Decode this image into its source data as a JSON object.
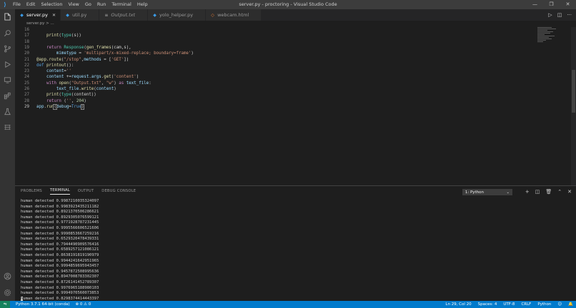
{
  "window": {
    "title": "server.py - proctoring - Visual Studio Code",
    "menu": [
      "File",
      "Edit",
      "Selection",
      "View",
      "Go",
      "Run",
      "Terminal",
      "Help"
    ],
    "controls": [
      "—",
      "❐",
      "✕"
    ]
  },
  "activity_bar": [
    "files-icon",
    "search-icon",
    "source-control-icon",
    "run-debug-icon",
    "remote-explorer-icon",
    "extensions-icon",
    "test-icon",
    "database-icon",
    "account-icon",
    "settings-gear-icon"
  ],
  "tabs": [
    {
      "label": "server.py",
      "icon": "python",
      "active": true
    },
    {
      "label": "util.py",
      "icon": "python",
      "active": false
    },
    {
      "label": "Output.txt",
      "icon": "text",
      "active": false
    },
    {
      "label": "yolo_helper.py",
      "icon": "python",
      "active": false
    },
    {
      "label": "webcam.html",
      "icon": "html",
      "active": false
    }
  ],
  "tab_actions": [
    "▷",
    "◫",
    "···"
  ],
  "breadcrumb": "server.py > ...",
  "editor": {
    "line_numbers": [
      "16",
      "17",
      "18",
      "19",
      "20",
      "21",
      "22",
      "23",
      "24",
      "25",
      "26",
      "27",
      "28",
      "29"
    ],
    "current_line": "29"
  },
  "panel": {
    "tabs": [
      "PROBLEMS",
      "TERMINAL",
      "OUTPUT",
      "DEBUG CONSOLE"
    ],
    "active_tab": "TERMINAL",
    "terminal_select": "1: Python",
    "controls": [
      "+",
      "◫",
      "🗑",
      "⌃",
      "✕"
    ],
    "terminal_lines": [
      "human detected 0.9987210035324097",
      "human detected 0.9983923435211182",
      "human detected 0.8921370506286621",
      "human detected 0.8929305076599121",
      "human detected 0.9771928787231445",
      "human detected 0.9995566606521606",
      "human detected 0.9990853667259216",
      "human detected 0.6529320478439331",
      "human detected 0.7944490909576416",
      "human detected 0.6589257121086121",
      "human detected 0.8638191819190979",
      "human detected 0.9944241642951965",
      "human detected 0.9994859695943457",
      "human detected 0.9457872508995636",
      "human detected 0.8947008783302307",
      "human detected 0.8726141452789307",
      "human detected 0.9976965188980103",
      "human detected 0.9994970560073853",
      "human detected 0.8298374414443397"
    ]
  },
  "status": {
    "interpreter": "Python 3.7.1 64-bit (conda)",
    "problems": "⊗ 0 ⚠ 0",
    "position": "Ln 29, Col 20",
    "spaces": "Spaces: 4",
    "encoding": "UTF-8",
    "eol": "CRLF",
    "language": "Python",
    "feedback": "☺",
    "bell": "🔔"
  },
  "colors": {
    "accent": "#007acc",
    "titlebar": "#3c3c3c",
    "activity": "#333333",
    "editor_bg": "#1e1e1e"
  }
}
